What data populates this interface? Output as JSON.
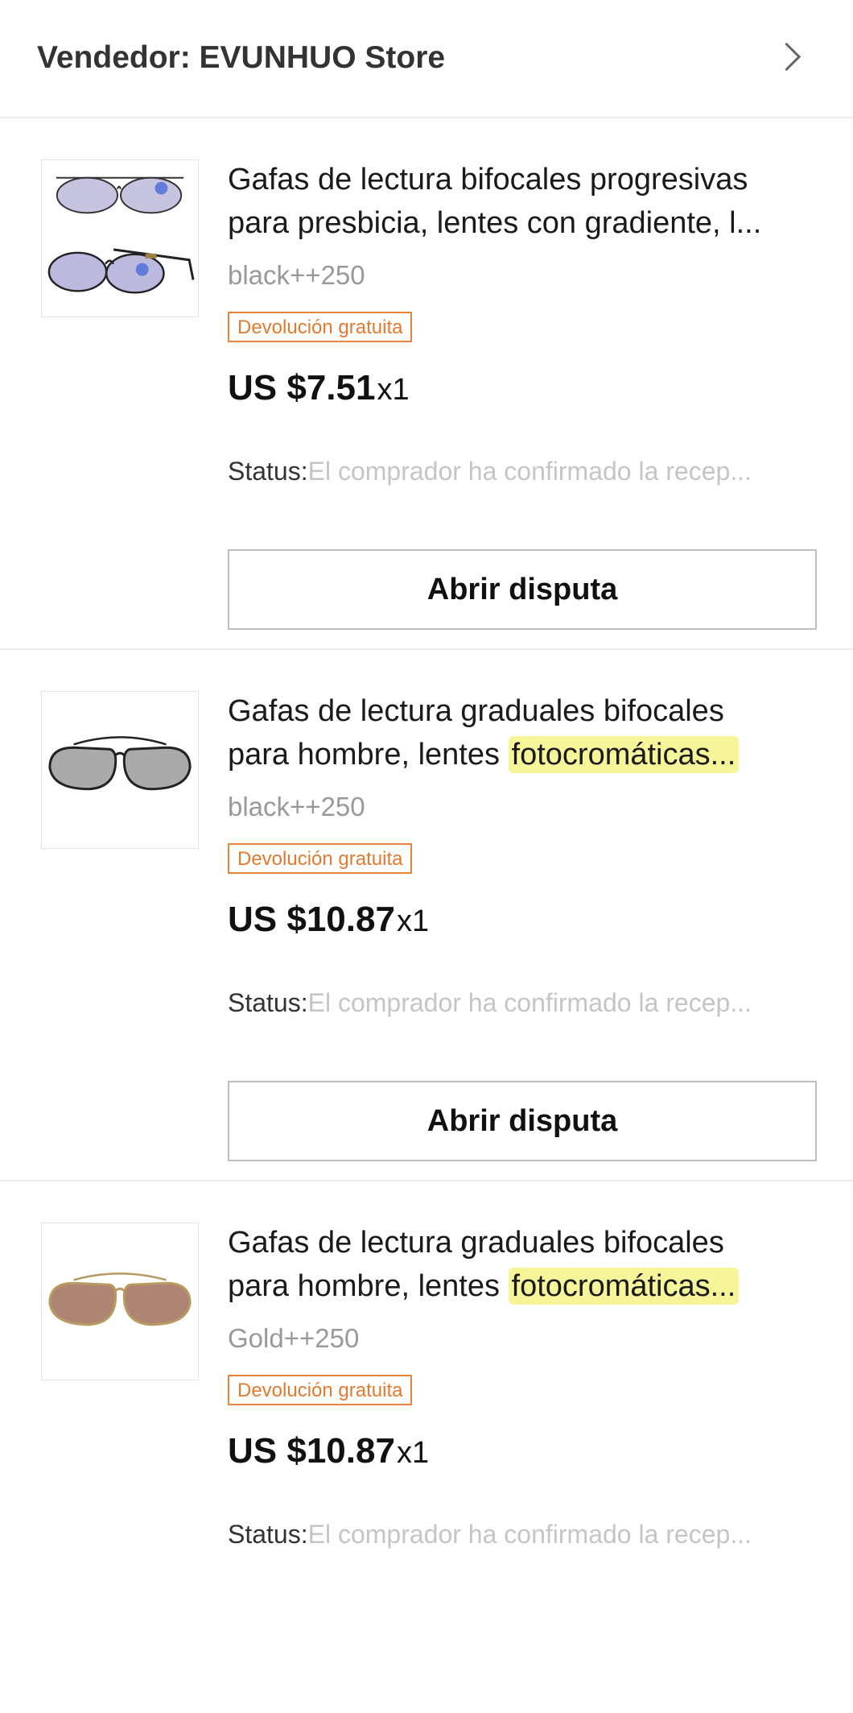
{
  "seller": {
    "label": "Vendedor: EVUNHUO Store"
  },
  "items": [
    {
      "title_line1": "Gafas de lectura bifocales progresivas",
      "title_line2_plain": "para presbicia, lentes con gradiente, l...",
      "title_line2_highlight": "",
      "variant": "black++250",
      "badge": "Devolución gratuita",
      "price": "US $7.51",
      "quantity": "x1",
      "status_label": "Status:",
      "status_value": "El comprador ha confirmado la recep...",
      "button": "Abrir disputa",
      "image_icon": "double-aviator-sunglasses-icon",
      "lens_color": "#b8b6d6"
    },
    {
      "title_line1": "Gafas de lectura graduales bifocales",
      "title_line2_plain": "para hombre, lentes ",
      "title_line2_highlight": "fotocromáticas...",
      "variant": "black++250",
      "badge": "Devolución gratuita",
      "price": "US $10.87",
      "quantity": "x1",
      "status_label": "Status:",
      "status_value": "El comprador ha confirmado la recep...",
      "button": "Abrir disputa",
      "image_icon": "aviator-sunglasses-icon",
      "lens_color": "#9a9a9a"
    },
    {
      "title_line1": "Gafas de lectura graduales bifocales",
      "title_line2_plain": "para hombre, lentes ",
      "title_line2_highlight": "fotocromáticas...",
      "variant": "Gold++250",
      "badge": "Devolución gratuita",
      "price": "US $10.87",
      "quantity": "x1",
      "status_label": "Status:",
      "status_value": "El comprador ha confirmado la recep...",
      "button": "",
      "image_icon": "aviator-sunglasses-icon",
      "lens_color": "#a0705a"
    }
  ],
  "colors": {
    "badge": "#e27a2f",
    "highlight": "#f7f59a",
    "status_value": "#c5c5c5"
  }
}
